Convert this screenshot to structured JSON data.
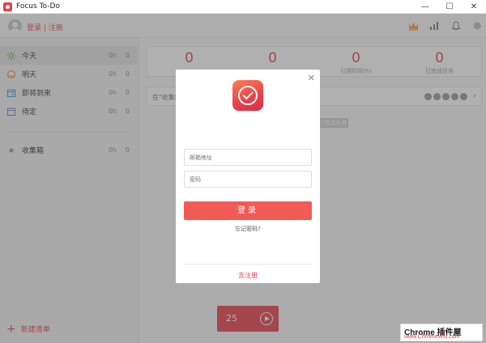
{
  "window": {
    "title": "Focus To-Do",
    "minimize": "—",
    "maximize": "☐",
    "close": "✕"
  },
  "header": {
    "login_link": "登录 | 注册",
    "icons": [
      "crown-icon",
      "stats-icon",
      "bell-icon",
      "gear-icon"
    ]
  },
  "sidebar": {
    "items": [
      {
        "label": "今天",
        "hours": "0h",
        "count": "0",
        "icon": "sun-icon",
        "color": "#6ab04c"
      },
      {
        "label": "明天",
        "hours": "0h",
        "count": "0",
        "icon": "sunset-icon",
        "color": "#f0932b"
      },
      {
        "label": "即将到来",
        "hours": "0h",
        "count": "0",
        "icon": "calendar-icon",
        "color": "#4a90d9"
      },
      {
        "label": "待定",
        "hours": "0h",
        "count": "0",
        "icon": "calendar-pending-icon",
        "color": "#8e7cc3"
      }
    ],
    "inbox": {
      "label": "收集箱",
      "hours": "0h",
      "count": "0"
    },
    "new_list": "新建清单"
  },
  "main": {
    "stats": [
      {
        "value": "0",
        "caption": ""
      },
      {
        "value": "0",
        "caption": ""
      },
      {
        "value": "0",
        "caption": "已用时间(h)"
      },
      {
        "value": "0",
        "caption": "已完成任务"
      }
    ],
    "task_placeholder": "在\"收集箱\"",
    "done_chip": "已完成任务"
  },
  "timer": {
    "minutes": "25"
  },
  "dialog": {
    "email_placeholder": "邮箱地址",
    "password_placeholder": "密码",
    "login_button": "登录",
    "forgot": "忘记密码?",
    "register": "去注册"
  },
  "watermark": {
    "line1": "Chrome 插件屋",
    "line2": "www.ChromeWU.com"
  },
  "colors": {
    "accent": "#e8414c",
    "button": "#f25a55"
  }
}
